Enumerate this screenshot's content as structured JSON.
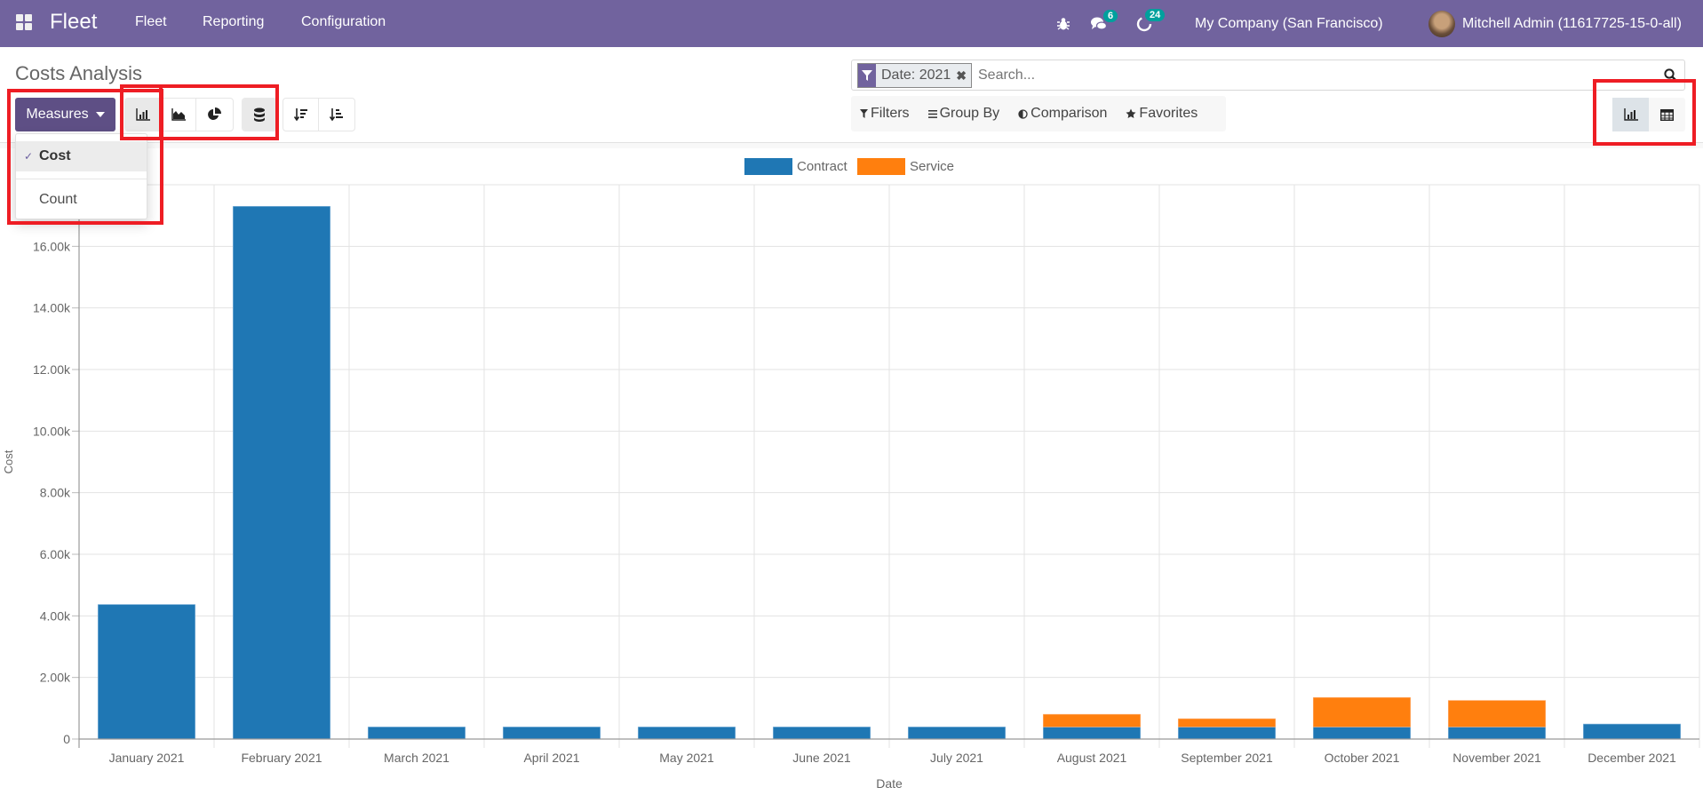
{
  "navbar": {
    "app_name": "Fleet",
    "menu": [
      "Fleet",
      "Reporting",
      "Configuration"
    ],
    "messages_count": "6",
    "activities_count": "24",
    "company": "My Company (San Francisco)",
    "user": "Mitchell Admin (11617725-15-0-all)"
  },
  "page": {
    "title": "Costs Analysis"
  },
  "toolbar": {
    "measures_label": "Measures",
    "measures_options": [
      {
        "label": "Cost",
        "selected": true
      },
      {
        "label": "Count",
        "selected": false
      }
    ],
    "chart_types": [
      "bar-chart",
      "line-chart",
      "pie-chart"
    ],
    "active_chart_type": "bar-chart",
    "stacked": true
  },
  "search": {
    "facet_label": "Date: 2021",
    "placeholder": "Search..."
  },
  "filters": {
    "filters_label": "Filters",
    "groupby_label": "Group By",
    "comparison_label": "Comparison",
    "favorites_label": "Favorites"
  },
  "views": [
    "graph",
    "pivot"
  ],
  "active_view": "graph",
  "colors": {
    "brand": "#71639e",
    "contract": "#1f77b4",
    "service": "#ff7f0e"
  },
  "chart_data": {
    "type": "bar",
    "stacked": true,
    "title": "",
    "xlabel": "Date",
    "ylabel": "Cost",
    "ylim": [
      0,
      18000
    ],
    "yticks": [
      0,
      2000,
      4000,
      6000,
      8000,
      10000,
      12000,
      14000,
      16000
    ],
    "ytick_labels": [
      "0",
      "2.00k",
      "4.00k",
      "6.00k",
      "8.00k",
      "10.00k",
      "12.00k",
      "14.00k",
      "16.00k"
    ],
    "grid": true,
    "legend_position": "top-center",
    "categories": [
      "January 2021",
      "February 2021",
      "March 2021",
      "April 2021",
      "May 2021",
      "June 2021",
      "July 2021",
      "August 2021",
      "September 2021",
      "October 2021",
      "November 2021",
      "December 2021"
    ],
    "series": [
      {
        "name": "Contract",
        "color": "#1f77b4",
        "values": [
          4370,
          17300,
          393,
          393,
          393,
          393,
          393,
          393,
          393,
          393,
          393,
          488
        ]
      },
      {
        "name": "Service",
        "color": "#ff7f0e",
        "values": [
          0,
          0,
          0,
          0,
          0,
          0,
          0,
          410,
          267,
          956,
          861,
          0
        ]
      }
    ]
  }
}
